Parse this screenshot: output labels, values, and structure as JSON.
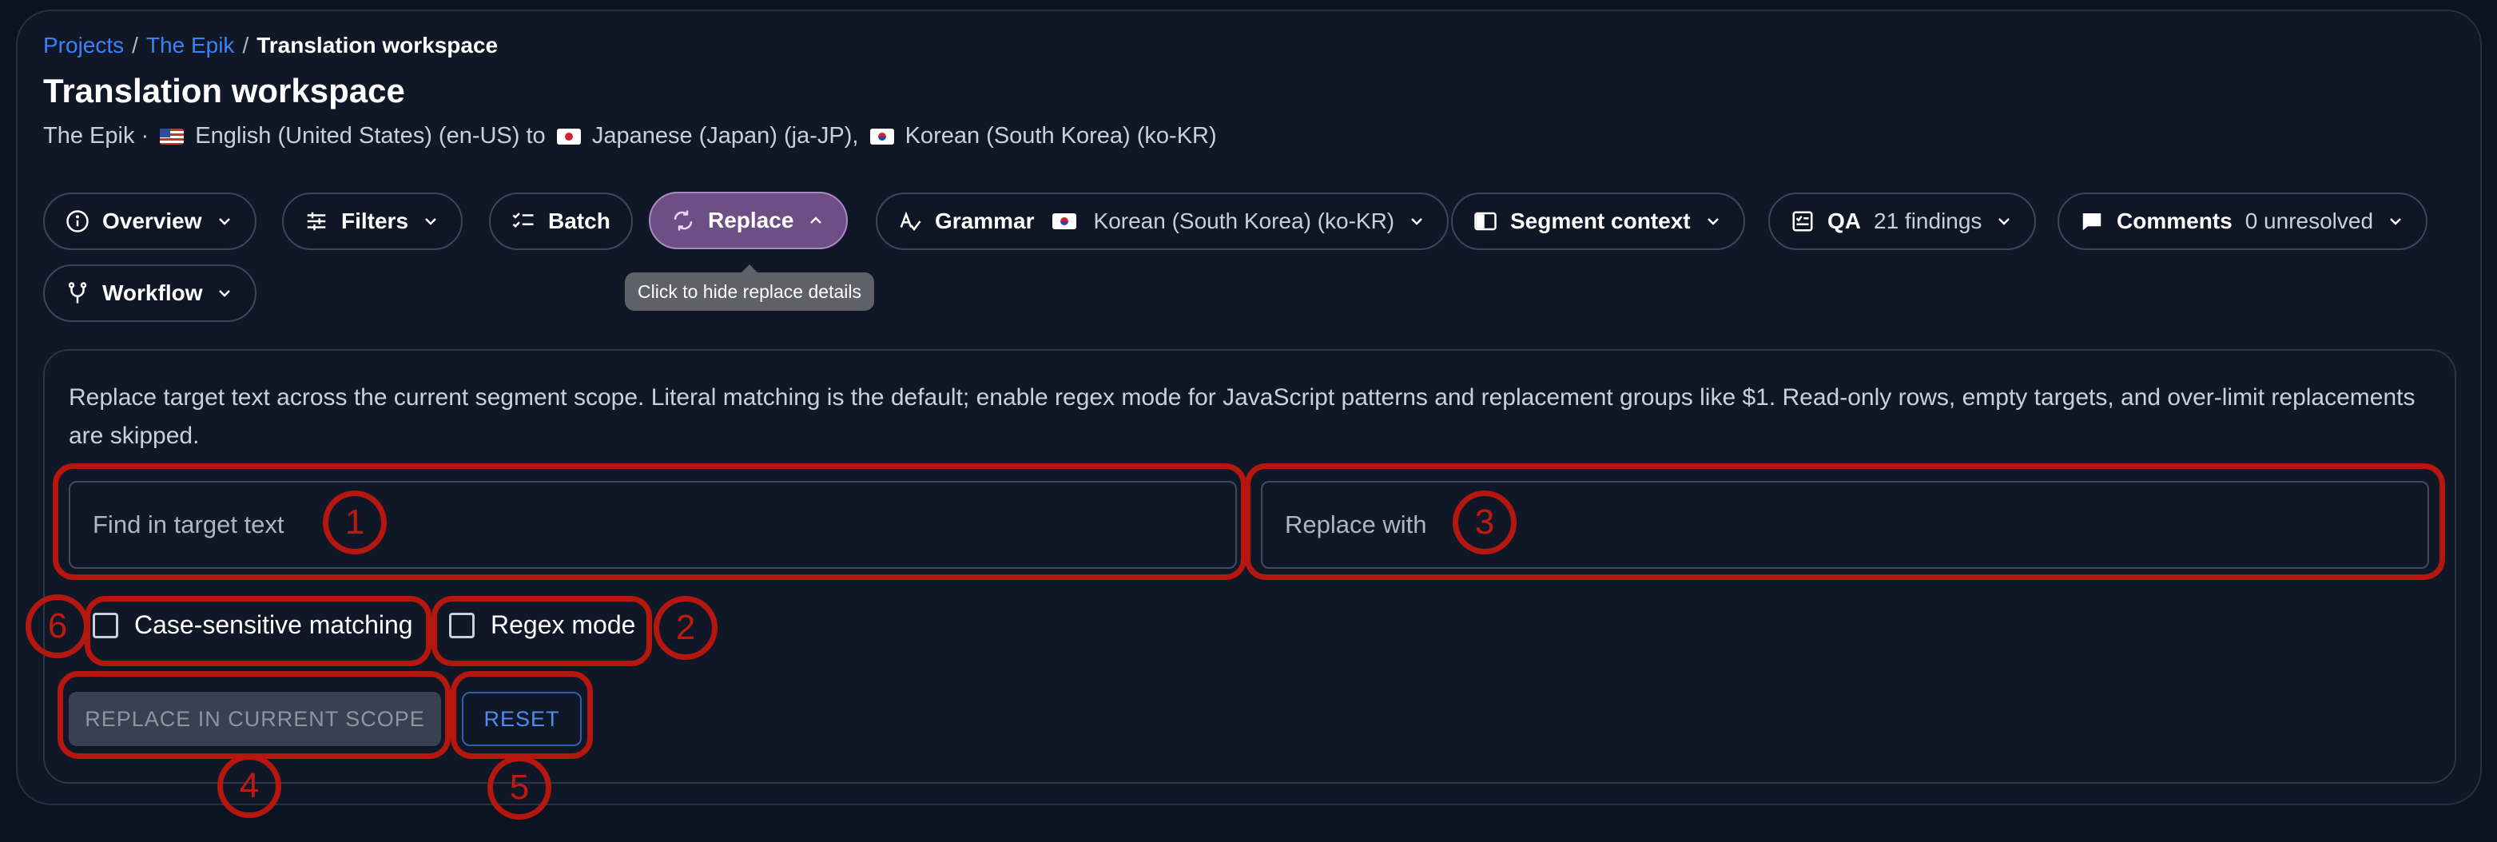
{
  "breadcrumb": {
    "projects": "Projects",
    "separator": "/",
    "project": "The Epik",
    "current": "Translation workspace"
  },
  "header": {
    "title": "Translation workspace",
    "subtitle_prefix": "The Epik · ",
    "source_language": "English (United States) (en-US)",
    "connector": " to ",
    "target_language_1": "Japanese (Japan) (ja-JP),",
    "target_language_2": "Korean (South Korea) (ko-KR)"
  },
  "toolbar": {
    "overview": "Overview",
    "filters": "Filters",
    "batch": "Batch",
    "replace": "Replace",
    "grammar": "Grammar",
    "grammar_language": "Korean (South Korea) (ko-KR)",
    "segment_context": "Segment context",
    "qa": "QA",
    "qa_meta": "21 findings",
    "comments": "Comments",
    "comments_meta": "0 unresolved",
    "workflow": "Workflow"
  },
  "tooltip": "Click to hide replace details",
  "replace_panel": {
    "description": "Replace target text across the current segment scope. Literal matching is the default; enable regex mode for JavaScript patterns and replacement groups like $1. Read-only rows, empty targets, and over-limit replacements are skipped.",
    "find_placeholder": "Find in target text",
    "replace_placeholder": "Replace with",
    "case_sensitive_label": "Case-sensitive matching",
    "regex_label": "Regex mode",
    "replace_button": "REPLACE IN CURRENT SCOPE",
    "reset_button": "RESET"
  },
  "annotations": [
    "1",
    "2",
    "3",
    "4",
    "5",
    "6"
  ],
  "colors": {
    "background": "#0b1220",
    "accent": "#3b82f6",
    "active_chip": "#6d4f86",
    "annotation": "#b5160e"
  }
}
